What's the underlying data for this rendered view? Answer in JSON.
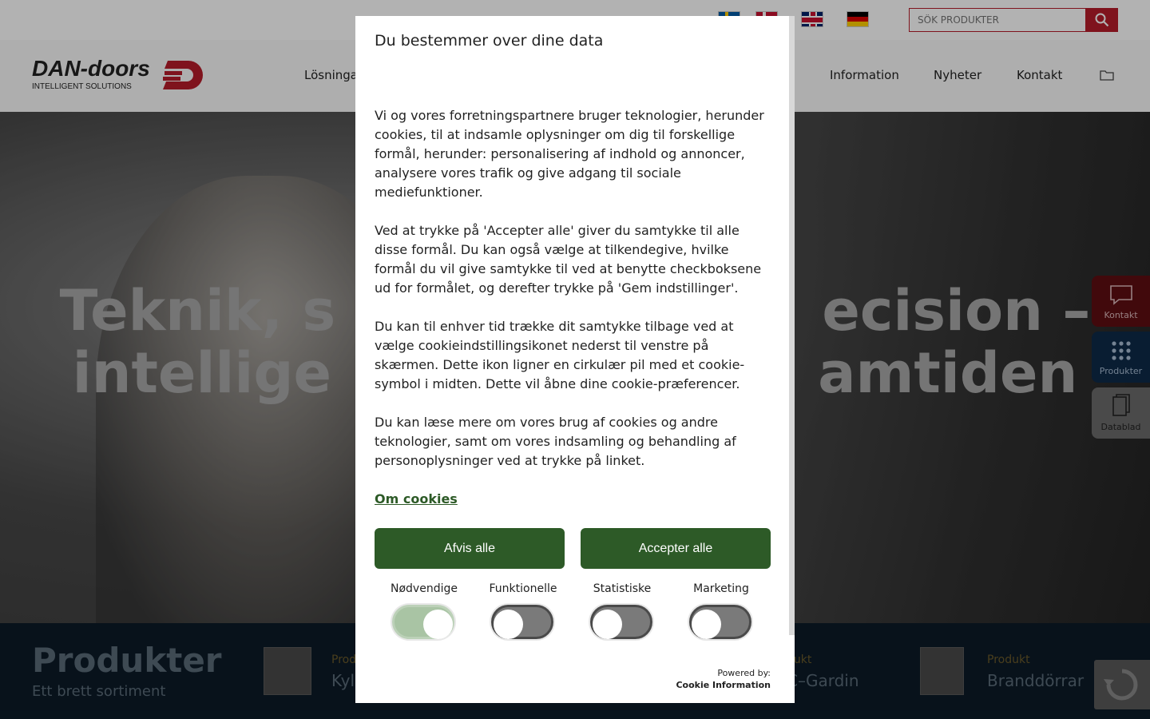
{
  "topbar": {
    "flags": [
      "Swedish",
      "Danish",
      "English",
      "German"
    ],
    "search_placeholder": "SÖK PRODUKTER"
  },
  "header": {
    "logo_text": "DAN-doors",
    "logo_sub": "INTELLIGENT SOLUTIONS",
    "nav": [
      "Lösninga",
      "Information",
      "Nyheter",
      "Kontakt"
    ]
  },
  "hero": {
    "title_line1": "Teknik, s                         ecision –",
    "title_line2": "intellige                         amtiden"
  },
  "side_buttons": {
    "kontakt": "Kontakt",
    "produkter": "Produkter",
    "datablad": "Datablad"
  },
  "products_strip": {
    "title": "Produkter",
    "subtitle": "Ett brett sortiment",
    "items": [
      {
        "kicker": "Prod",
        "name": "Kyl"
      },
      {
        "kicker": "dukt",
        "name": "C–Gardin"
      },
      {
        "kicker": "Produkt",
        "name": "Branddörrar"
      }
    ]
  },
  "cookie_dialog": {
    "title": "Du bestemmer over dine data",
    "paragraphs": [
      "Vi og vores forretningspartnere bruger teknologier, herunder cookies, til at indsamle oplysninger om dig til forskellige formål, herunder: personalisering af indhold og annoncer, analysere vores trafik og give adgang til sociale mediefunktioner.",
      "Ved at trykke på 'Accepter alle' giver du samtykke til alle disse formål. Du kan også vælge at tilkendegive, hvilke formål du vil give samtykke til ved at benytte checkboksene ud for formålet, og derefter trykke på 'Gem indstillinger'.",
      "Du kan til enhver tid trække dit samtykke tilbage ved at vælge cookieindstillingsikonet nederst til venstre på skærmen. Dette ikon ligner en cirkulær pil med et cookie-symbol i midten. Dette vil åbne dine cookie-præferencer.",
      "Du kan læse mere om vores brug af cookies og andre teknologier, samt om vores indsamling og behandling af personoplysninger ved at trykke på linket."
    ],
    "link": "Om cookies",
    "reject_label": "Afvis alle",
    "accept_label": "Accepter alle",
    "categories": [
      {
        "label": "Nødvendige",
        "on": true
      },
      {
        "label": "Funktionelle",
        "on": false
      },
      {
        "label": "Statistiske",
        "on": false
      },
      {
        "label": "Marketing",
        "on": false
      }
    ],
    "powered_by": "Powered by:",
    "provider": "Cookie Information"
  },
  "colors": {
    "brand_red": "#b71c2a",
    "consent_green": "#2d5a27",
    "toggle_on": "#a9c4a4",
    "strip_bg": "#0c1b28"
  }
}
